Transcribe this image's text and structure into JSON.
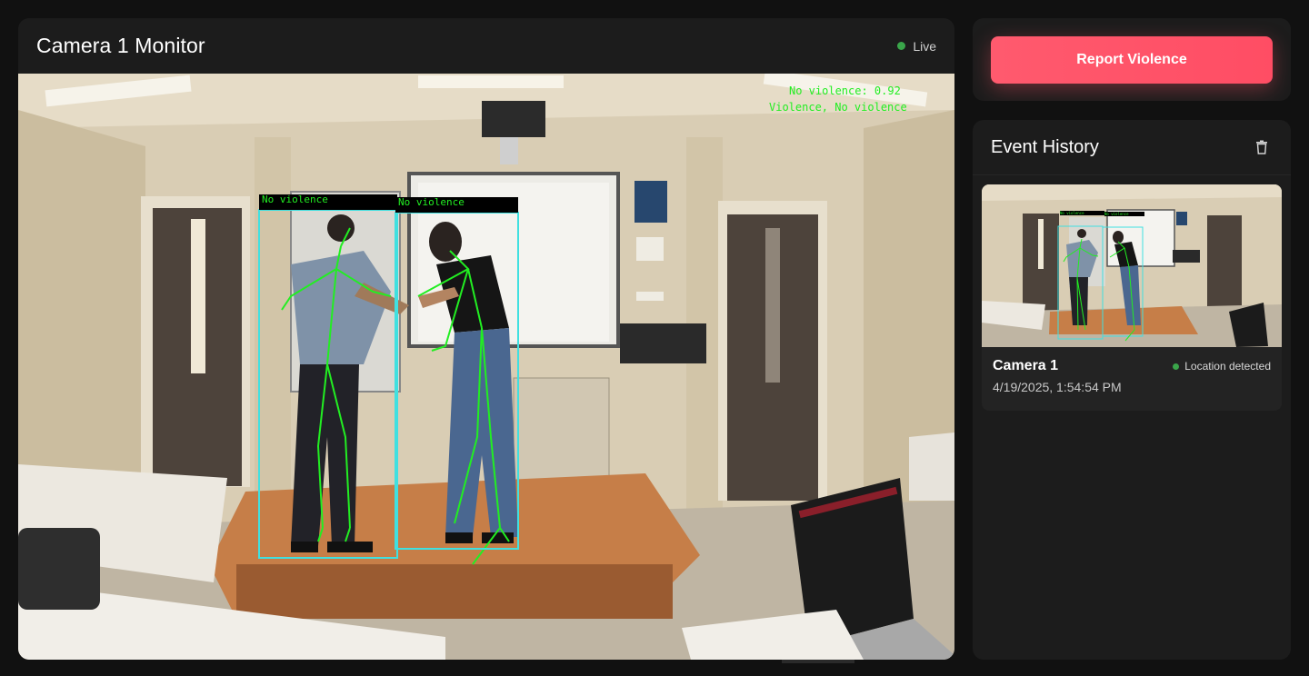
{
  "monitor": {
    "title": "Camera 1 Monitor",
    "status_label": "Live"
  },
  "feed": {
    "overlay_lines": [
      "No violence: 0.92",
      "Violence, No violence"
    ],
    "box_labels": [
      "No violence",
      "No violence"
    ]
  },
  "actions": {
    "report_label": "Report Violence"
  },
  "history": {
    "title": "Event History",
    "events": [
      {
        "camera": "Camera 1",
        "location_status": "Location detected",
        "timestamp": "4/19/2025, 1:54:54 PM",
        "thumb_labels": [
          "No violence",
          "No violence"
        ]
      }
    ]
  },
  "colors": {
    "accent": "#ff5a6e",
    "live": "#3aa54a",
    "detection": "#22ee22",
    "box": "#40e0e0"
  }
}
